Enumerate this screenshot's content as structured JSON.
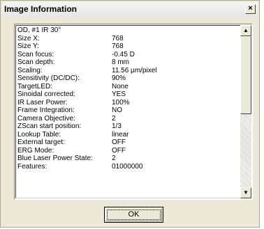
{
  "dialog": {
    "title": "Image Information",
    "close_glyph": "×",
    "ok_label": "OK"
  },
  "info": {
    "header": "OD, #1 IR 30°",
    "rows": [
      {
        "k": "Size X:",
        "v": "768"
      },
      {
        "k": "Size Y:",
        "v": "768"
      },
      {
        "k": "Scan focus:",
        "v": "-0.45 D"
      },
      {
        "k": "Scan depth:",
        "v": "8 mm"
      },
      {
        "k": "Scaling:",
        "v": "11.56 µm/pixel"
      },
      {
        "k": "Sensitivity (DC/DC):",
        "v": "90%"
      },
      {
        "k": "TargetLED:",
        "v": "None"
      },
      {
        "k": "Sinoidal corrected:",
        "v": "YES"
      },
      {
        "k": "IR Laser Power:",
        "v": "100%"
      },
      {
        "k": "Frame Integration:",
        "v": "NO"
      },
      {
        "k": "Camera Objective:",
        "v": "2"
      },
      {
        "k": "ZScan start position:",
        "v": "1/3"
      },
      {
        "k": "Lookup Table:",
        "v": "linear"
      },
      {
        "k": "External target:",
        "v": "OFF"
      },
      {
        "k": "ERG Mode:",
        "v": "OFF"
      },
      {
        "k": "Blue Laser Power State:",
        "v": "2"
      },
      {
        "k": "Features:",
        "v": "01000000"
      }
    ]
  },
  "scrollbar": {
    "up_glyph": "▲",
    "down_glyph": "▼",
    "up_icon": "arrow-up-icon",
    "down_icon": "arrow-down-icon"
  }
}
